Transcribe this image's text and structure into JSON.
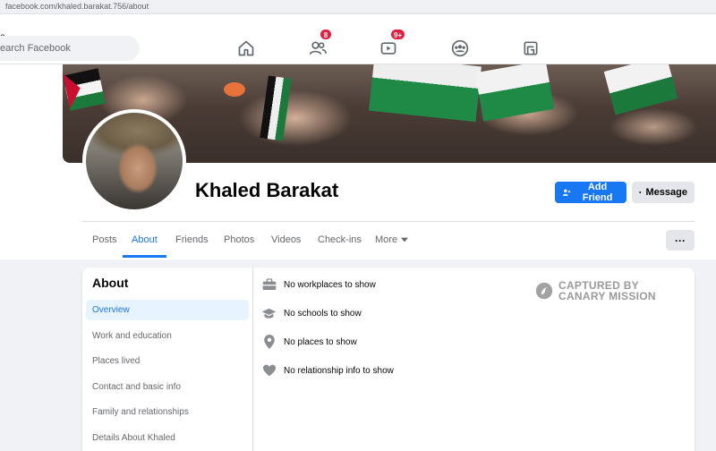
{
  "browser": {
    "url": "facebook.com/khaled.barakat.756/about"
  },
  "topnav": {
    "search_placeholder": "earch Facebook",
    "left_edge_text": "e",
    "icons": [
      {
        "name": "home-icon",
        "badge": ""
      },
      {
        "name": "friends-icon",
        "badge": "8"
      },
      {
        "name": "watch-icon",
        "badge": "9+"
      },
      {
        "name": "groups-icon",
        "badge": ""
      },
      {
        "name": "gaming-icon",
        "badge": ""
      }
    ]
  },
  "profile": {
    "name": "Khaled Barakat",
    "add_friend_label": "Add Friend",
    "message_label": "Message"
  },
  "tabs": {
    "posts": "Posts",
    "about": "About",
    "friends": "Friends",
    "photos": "Photos",
    "videos": "Videos",
    "checkins": "Check-ins",
    "more": "More",
    "more_menu": "···"
  },
  "about": {
    "title": "About",
    "sidebar": [
      "Overview",
      "Work and education",
      "Places lived",
      "Contact and basic info",
      "Family and relationships",
      "Details About Khaled"
    ],
    "rows": [
      {
        "icon": "briefcase-icon",
        "text": "No workplaces to show"
      },
      {
        "icon": "graduation-cap-icon",
        "text": "No schools to show"
      },
      {
        "icon": "location-pin-icon",
        "text": "No places to show"
      },
      {
        "icon": "heart-icon",
        "text": "No relationship info to show"
      }
    ]
  },
  "watermark": {
    "line1": "CAPTURED BY",
    "line2": "CANARY MISSION"
  },
  "colors": {
    "accent": "#1877f2",
    "badge": "#e41e3f",
    "background": "#f0f2f5"
  }
}
